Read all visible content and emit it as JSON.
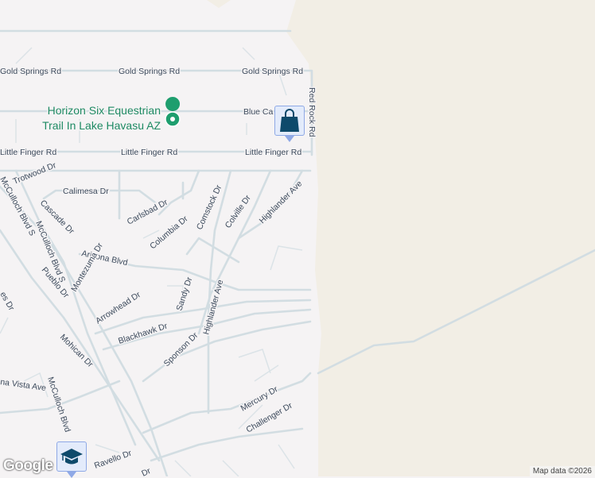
{
  "colors": {
    "land": "#f5f3f4",
    "desert": "#f2eee5",
    "road": "#d2dde2",
    "label": "#3c4a5c",
    "poi": "#1e8a63",
    "marker": "#0e4a6b"
  },
  "labels": {
    "gold_springs_1": "Gold Springs Rd",
    "gold_springs_2": "Gold Springs Rd",
    "gold_springs_3": "Gold Springs Rd",
    "blue_canyon": "Blue Ca",
    "red_rock": "Red Rock Rd",
    "little_finger_1": "Little Finger Rd",
    "little_finger_2": "Little Finger Rd",
    "little_finger_3": "Little Finger Rd",
    "trotwood": "Trotwood Dr",
    "calimesa": "Calimesa Dr",
    "cascade": "Cascade Dr",
    "carlsbad": "Carlsbad Dr",
    "comstock": "Comstock Dr",
    "colville": "Colville Dr",
    "highlander_1": "Highlander Ave",
    "highlander_2": "Highlander Ave",
    "columbia": "Columbia Dr",
    "arizona": "Arizona Blvd",
    "montezuma": "Montezuma Dr",
    "mcculloch_1": "McCulloch Blvd S",
    "mcculloch_2": "McCulloch Blvd S",
    "mcculloch_3": "McCulloch Blvd",
    "pueblo": "Pueblo Dr",
    "arrowhead": "Arrowhead Dr",
    "sandy": "Sandy Dr",
    "blackhawk": "Blackhawk Dr",
    "sponson": "Sponson Dr",
    "mohican": "Mohican Dr",
    "buena_vista": "na Vista Ave",
    "mercury": "Mercury Dr",
    "challenger": "Challenger Dr",
    "ravello": "Ravello Dr",
    "edge_dr": "es Dr",
    "edge_dr2": "Dr"
  },
  "poi": {
    "name_line1": "Horizon Six Equestrian",
    "name_line2": "Trail In Lake Havasu AZ"
  },
  "markers": {
    "shopping": "shopping-bag",
    "school": "graduation-cap"
  },
  "footer": {
    "logo": "Google",
    "attribution": "Map data ©2026"
  }
}
